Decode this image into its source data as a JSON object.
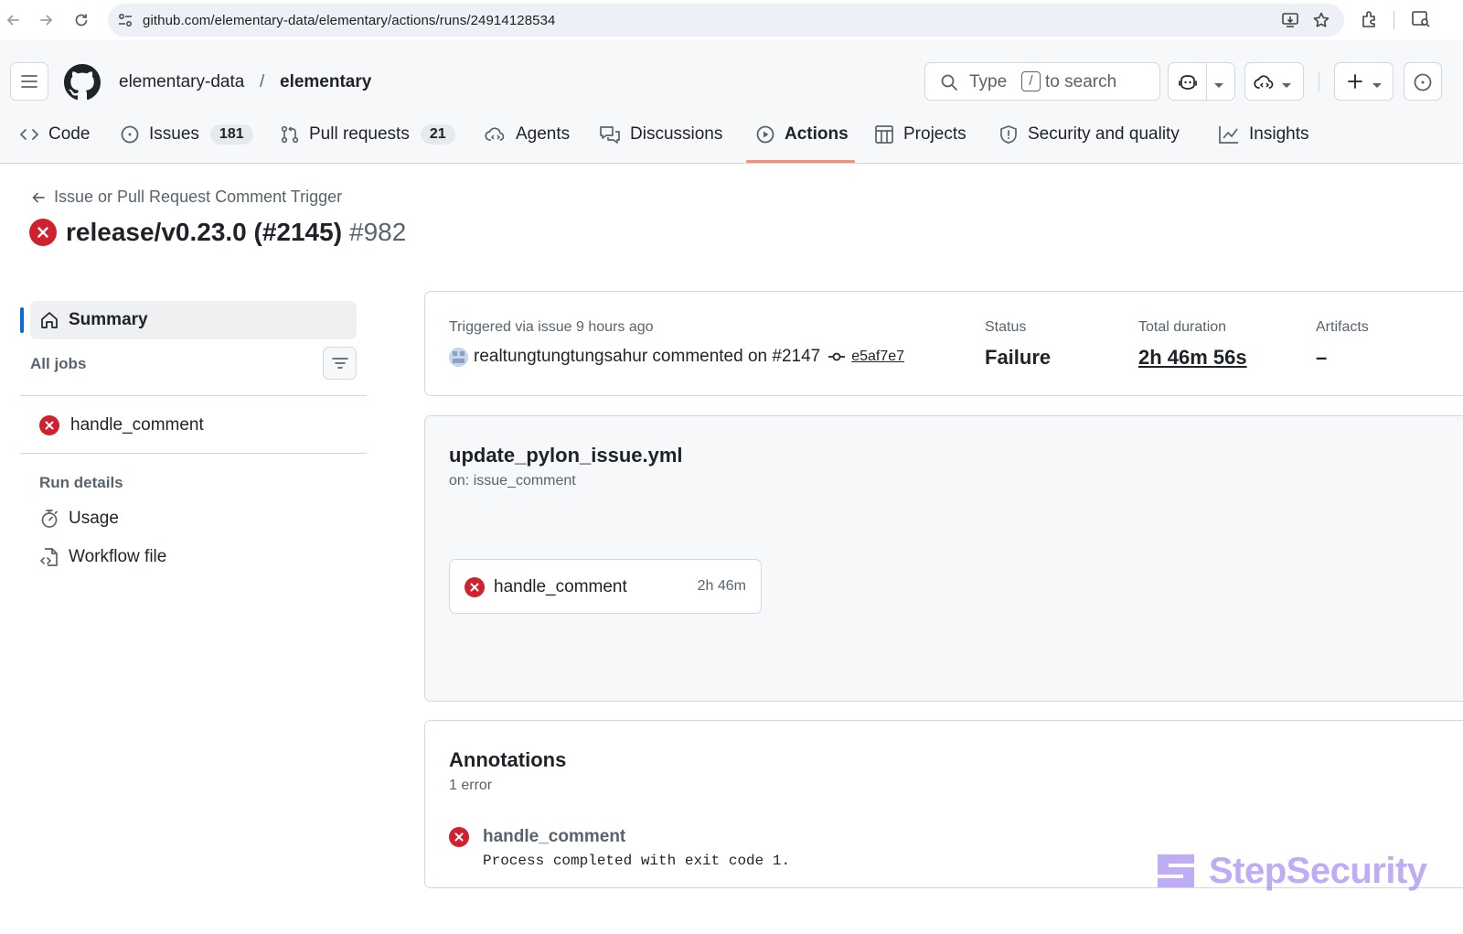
{
  "browser": {
    "url": "github.com/elementary-data/elementary/actions/runs/24914128534"
  },
  "header": {
    "owner": "elementary-data",
    "slash": "/",
    "repo": "elementary",
    "search_prefix": "Type",
    "search_key": "/",
    "search_suffix": "to search"
  },
  "tabs": [
    {
      "label": "Code",
      "icon": "code-icon"
    },
    {
      "label": "Issues",
      "count": "181",
      "icon": "issue-icon"
    },
    {
      "label": "Pull requests",
      "count": "21",
      "icon": "pull-request-icon"
    },
    {
      "label": "Agents",
      "icon": "agents-icon"
    },
    {
      "label": "Discussions",
      "icon": "discussions-icon"
    },
    {
      "label": "Actions",
      "icon": "play-icon",
      "selected": true
    },
    {
      "label": "Projects",
      "icon": "table-icon"
    },
    {
      "label": "Security and quality",
      "icon": "shield-icon"
    },
    {
      "label": "Insights",
      "icon": "graph-icon"
    }
  ],
  "run": {
    "workflow_link": "Issue or Pull Request Comment Trigger",
    "title": "release/v0.23.0 (#2145)",
    "number": "#982"
  },
  "sidebar": {
    "summary": "Summary",
    "all_jobs": "All jobs",
    "job": "handle_comment",
    "run_details": "Run details",
    "usage": "Usage",
    "workflow_file": "Workflow file"
  },
  "summary": {
    "trigger_label": "Triggered via issue 9 hours ago",
    "trigger_text": "realtungtungtungsahur commented on #2147",
    "commit_sha": "e5af7e7",
    "status_label": "Status",
    "status_value": "Failure",
    "duration_label": "Total duration",
    "duration_value": "2h 46m 56s",
    "artifacts_label": "Artifacts",
    "artifacts_value": "–"
  },
  "workflow": {
    "file": "update_pylon_issue.yml",
    "on": "on: issue_comment",
    "job_name": "handle_comment",
    "job_duration": "2h 46m"
  },
  "annotations": {
    "title": "Annotations",
    "count": "1 error",
    "item_title": "handle_comment",
    "item_message": "Process completed with exit code 1."
  },
  "watermark": "StepSecurity",
  "colors": {
    "accent_underline": "#fd8c73",
    "failure": "#cf222e",
    "active_bar": "#0969da",
    "watermark": "#a991f2"
  }
}
